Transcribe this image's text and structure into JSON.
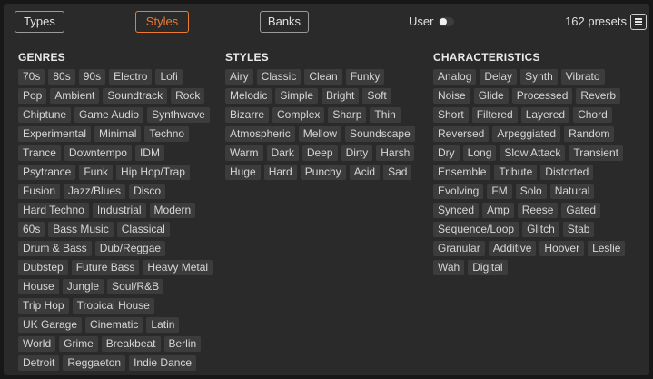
{
  "header": {
    "tabs": [
      {
        "label": "Types",
        "active": false
      },
      {
        "label": "Styles",
        "active": true
      },
      {
        "label": "Banks",
        "active": false
      }
    ],
    "user_label": "User",
    "user_toggle_on": false,
    "preset_count": "162 presets",
    "menu_icon": "hamburger-menu-icon",
    "accent_color": "#ee7a30"
  },
  "columns": [
    {
      "title": "GENRES",
      "tags": [
        "70s",
        "80s",
        "90s",
        "Electro",
        "Lofi",
        "Pop",
        "Ambient",
        "Soundtrack",
        "Rock",
        "Chiptune",
        "Game Audio",
        "Synthwave",
        "Experimental",
        "Minimal",
        "Techno",
        "Trance",
        "Downtempo",
        "IDM",
        "Psytrance",
        "Funk",
        "Hip Hop/Trap",
        "Fusion",
        "Jazz/Blues",
        "Disco",
        "Hard Techno",
        "Industrial",
        "Modern",
        "60s",
        "Bass Music",
        "Classical",
        "Drum & Bass",
        "Dub/Reggae",
        "Dubstep",
        "Future Bass",
        "Heavy Metal",
        "House",
        "Jungle",
        "Soul/R&B",
        "Trip Hop",
        "Tropical House",
        "UK Garage",
        "Cinematic",
        "Latin",
        "World",
        "Grime",
        "Breakbeat",
        "Berlin",
        "Detroit",
        "Reggaeton",
        "Indie Dance"
      ]
    },
    {
      "title": "STYLES",
      "tags": [
        "Airy",
        "Classic",
        "Clean",
        "Funky",
        "Melodic",
        "Simple",
        "Bright",
        "Soft",
        "Bizarre",
        "Complex",
        "Sharp",
        "Thin",
        "Atmospheric",
        "Mellow",
        "Soundscape",
        "Warm",
        "Dark",
        "Deep",
        "Dirty",
        "Harsh",
        "Huge",
        "Hard",
        "Punchy",
        "Acid",
        "Sad"
      ]
    },
    {
      "title": "CHARACTERISTICS",
      "tags": [
        "Analog",
        "Delay",
        "Synth",
        "Vibrato",
        "Noise",
        "Glide",
        "Processed",
        "Reverb",
        "Short",
        "Filtered",
        "Layered",
        "Chord",
        "Reversed",
        "Arpeggiated",
        "Random",
        "Dry",
        "Long",
        "Slow Attack",
        "Transient",
        "Ensemble",
        "Tribute",
        "Distorted",
        "Evolving",
        "FM",
        "Solo",
        "Natural",
        "Synced",
        "Amp",
        "Reese",
        "Gated",
        "Sequence/Loop",
        "Glitch",
        "Stab",
        "Granular",
        "Additive",
        "Hoover",
        "Leslie",
        "Wah",
        "Digital"
      ]
    }
  ]
}
